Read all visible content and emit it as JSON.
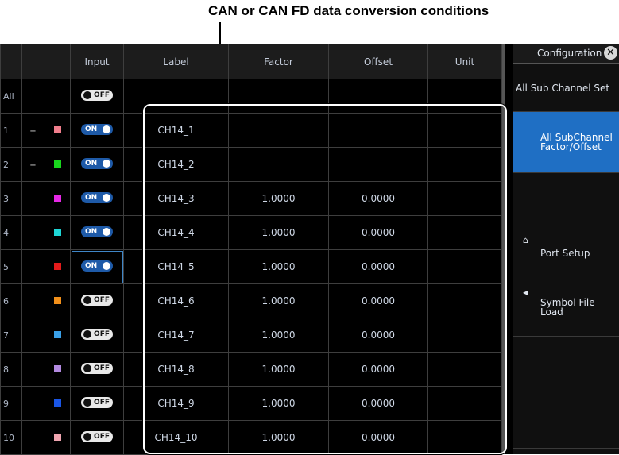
{
  "annotation": {
    "caption": "CAN or CAN FD data conversion conditions"
  },
  "table": {
    "columns": [
      "",
      "",
      "",
      "Input",
      "Label",
      "Factor",
      "Offset",
      "Unit"
    ],
    "all_row": {
      "index": "All",
      "input": "OFF"
    },
    "rows": [
      {
        "index": "1",
        "mark": "+",
        "color": "#f07e8c",
        "input": "ON",
        "label": "CH14_1",
        "factor": "",
        "offset": "",
        "unit": ""
      },
      {
        "index": "2",
        "mark": "+",
        "color": "#19d61d",
        "input": "ON",
        "label": "CH14_2",
        "factor": "",
        "offset": "",
        "unit": ""
      },
      {
        "index": "3",
        "mark": "",
        "color": "#e629e6",
        "input": "ON",
        "label": "CH14_3",
        "factor": "1.0000",
        "offset": "0.0000",
        "unit": ""
      },
      {
        "index": "4",
        "mark": "",
        "color": "#1ed6d6",
        "input": "ON",
        "label": "CH14_4",
        "factor": "1.0000",
        "offset": "0.0000",
        "unit": ""
      },
      {
        "index": "5",
        "mark": "",
        "color": "#e31b1b",
        "input": "ON",
        "label": "CH14_5",
        "factor": "1.0000",
        "offset": "0.0000",
        "unit": ""
      },
      {
        "index": "6",
        "mark": "",
        "color": "#f2901a",
        "input": "OFF",
        "label": "CH14_6",
        "factor": "1.0000",
        "offset": "0.0000",
        "unit": ""
      },
      {
        "index": "7",
        "mark": "",
        "color": "#3aa0e8",
        "input": "OFF",
        "label": "CH14_7",
        "factor": "1.0000",
        "offset": "0.0000",
        "unit": ""
      },
      {
        "index": "8",
        "mark": "",
        "color": "#b38ae0",
        "input": "OFF",
        "label": "CH14_8",
        "factor": "1.0000",
        "offset": "0.0000",
        "unit": ""
      },
      {
        "index": "9",
        "mark": "",
        "color": "#1a56e6",
        "input": "OFF",
        "label": "CH14_9",
        "factor": "1.0000",
        "offset": "0.0000",
        "unit": ""
      },
      {
        "index": "10",
        "mark": "",
        "color": "#efa5b0",
        "input": "OFF",
        "label": "CH14_10",
        "factor": "1.0000",
        "offset": "0.0000",
        "unit": ""
      }
    ]
  },
  "side_menu": {
    "title": "Configuration",
    "close_icon": "close-icon",
    "items": [
      {
        "label": "All Sub Channel Set",
        "icon": ""
      },
      {
        "label": "All SubChannel\nFactor/Offset",
        "icon": ""
      },
      {
        "label": "",
        "icon": ""
      },
      {
        "label": "Port Setup",
        "icon": "port-icon"
      },
      {
        "label": "Symbol File\nLoad",
        "icon": "triangle-left-icon"
      },
      {
        "label": "",
        "icon": ""
      }
    ]
  },
  "colors": {
    "accent": "#1f6fc4",
    "toggle_on": "#1e5aa8",
    "toggle_off": "#e9e9e9",
    "background": "#000000"
  }
}
